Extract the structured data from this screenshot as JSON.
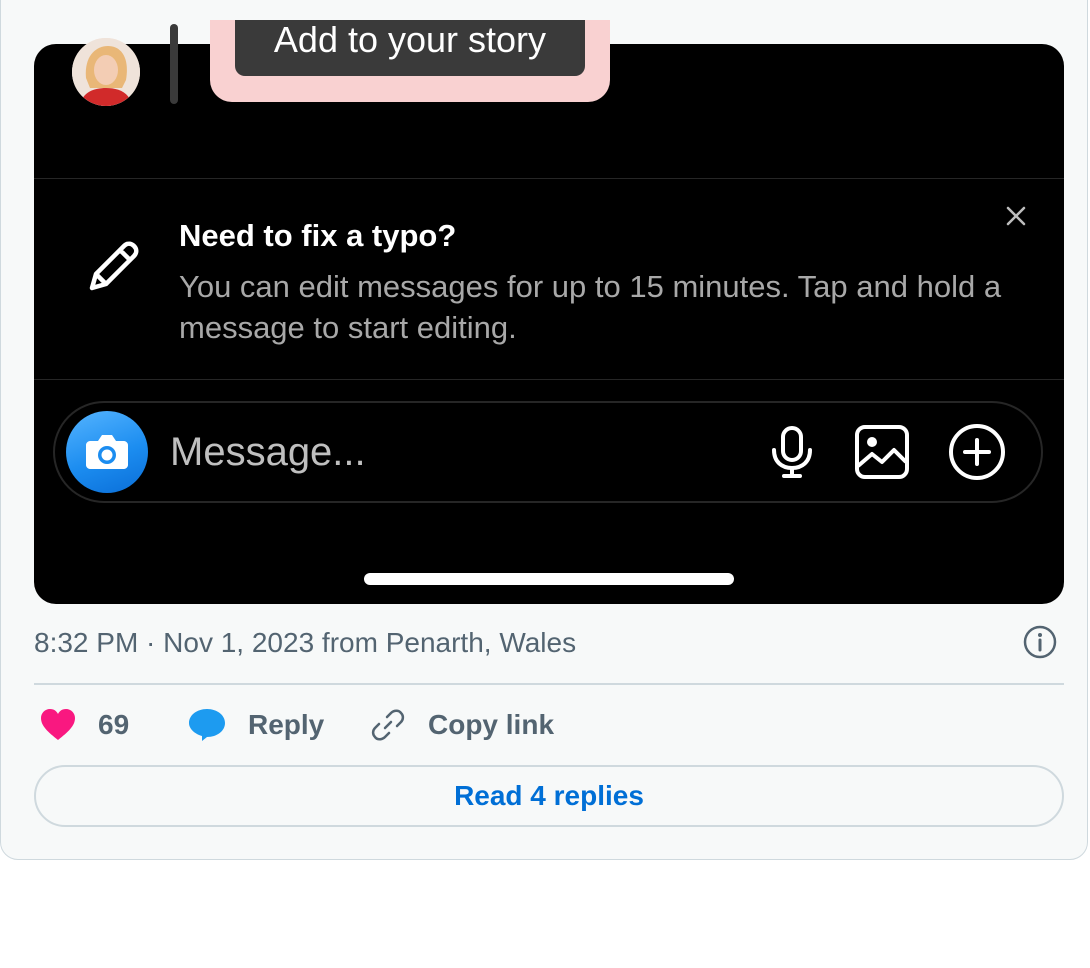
{
  "story": {
    "button_label": "Add to your story"
  },
  "tip": {
    "title": "Need to fix a typo?",
    "body": "You can edit messages for up to 15 minutes. Tap and hold a message to start editing.",
    "close_icon": "close-icon"
  },
  "composer": {
    "placeholder": "Message...",
    "icons": [
      "camera-icon",
      "microphone-icon",
      "image-icon",
      "plus-circle-icon"
    ]
  },
  "meta": {
    "timestamp": "8:32 PM · Nov 1, 2023 from Penarth, Wales"
  },
  "actions": {
    "like_count": "69",
    "reply_label": "Reply",
    "copy_label": "Copy link"
  },
  "replies_button": "Read 4 replies",
  "colors": {
    "like": "#f91880",
    "reply": "#1d9bf0",
    "link_text": "#006fd6",
    "camera_button": "#1c8df0",
    "story_highlight": "#f9d1d1"
  }
}
